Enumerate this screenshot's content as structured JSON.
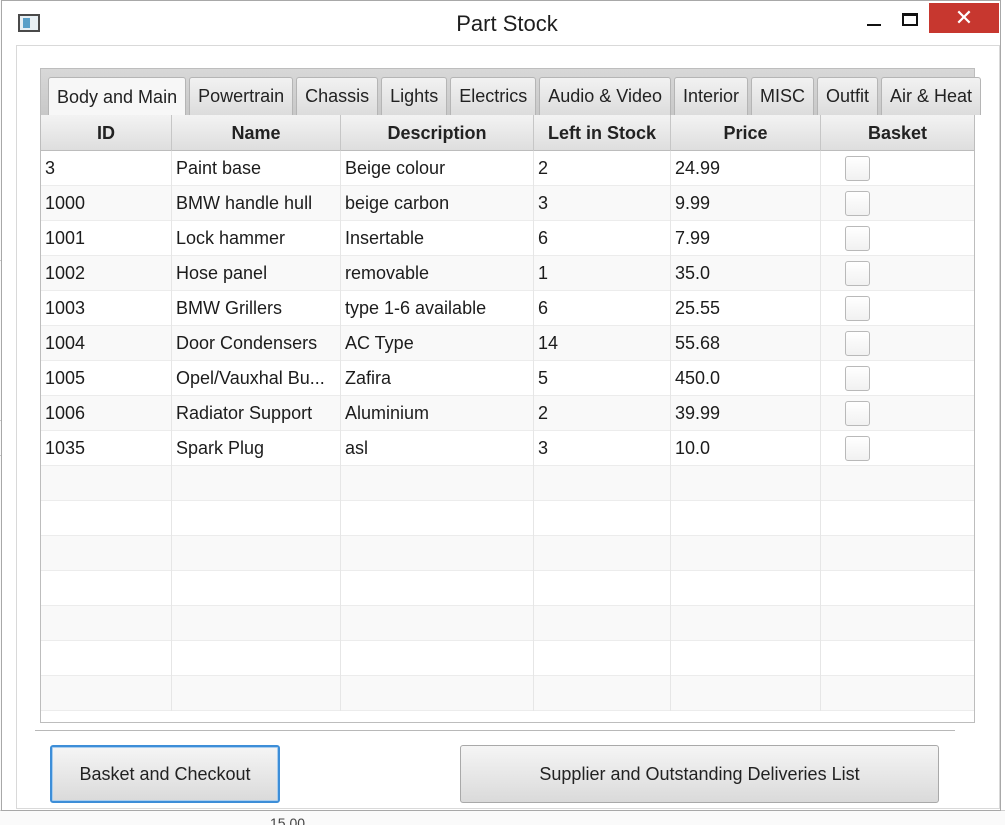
{
  "window": {
    "title": "Part Stock",
    "close_glyph": "✕"
  },
  "background": {
    "bottom_text": "15.00"
  },
  "tabs": [
    {
      "label": "Body and Main",
      "active": true
    },
    {
      "label": "Powertrain",
      "active": false
    },
    {
      "label": "Chassis",
      "active": false
    },
    {
      "label": "Lights",
      "active": false
    },
    {
      "label": "Electrics",
      "active": false
    },
    {
      "label": "Audio & Video",
      "active": false
    },
    {
      "label": "Interior",
      "active": false
    },
    {
      "label": "MISC",
      "active": false
    },
    {
      "label": "Outfit",
      "active": false
    },
    {
      "label": "Air & Heat",
      "active": false
    }
  ],
  "table": {
    "columns": [
      "ID",
      "Name",
      "Description",
      "Left in Stock",
      "Price",
      "Basket"
    ],
    "rows": [
      {
        "id": "3",
        "name": "Paint base",
        "description": "Beige colour",
        "stock": "2",
        "price": "24.99",
        "basket": false
      },
      {
        "id": "1000",
        "name": "BMW handle hull",
        "description": "beige carbon",
        "stock": "3",
        "price": "9.99",
        "basket": false
      },
      {
        "id": "1001",
        "name": "Lock hammer",
        "description": "Insertable",
        "stock": "6",
        "price": "7.99",
        "basket": false
      },
      {
        "id": "1002",
        "name": "Hose panel",
        "description": "removable",
        "stock": "1",
        "price": "35.0",
        "basket": false
      },
      {
        "id": "1003",
        "name": "BMW Grillers",
        "description": "type 1-6 available",
        "stock": "6",
        "price": "25.55",
        "basket": false
      },
      {
        "id": "1004",
        "name": "Door Condensers",
        "description": "AC Type",
        "stock": "14",
        "price": "55.68",
        "basket": false
      },
      {
        "id": "1005",
        "name": "Opel/Vauxhal Bu...",
        "description": "Zafira",
        "stock": "5",
        "price": "450.0",
        "basket": false
      },
      {
        "id": "1006",
        "name": "Radiator Support",
        "description": "Aluminium",
        "stock": "2",
        "price": "39.99",
        "basket": false
      },
      {
        "id": "1035",
        "name": "Spark Plug",
        "description": "asl",
        "stock": "3",
        "price": "10.0",
        "basket": false
      }
    ]
  },
  "buttons": {
    "basket_checkout": "Basket and Checkout",
    "supplier_deliveries": "Supplier and Outstanding Deliveries List"
  }
}
